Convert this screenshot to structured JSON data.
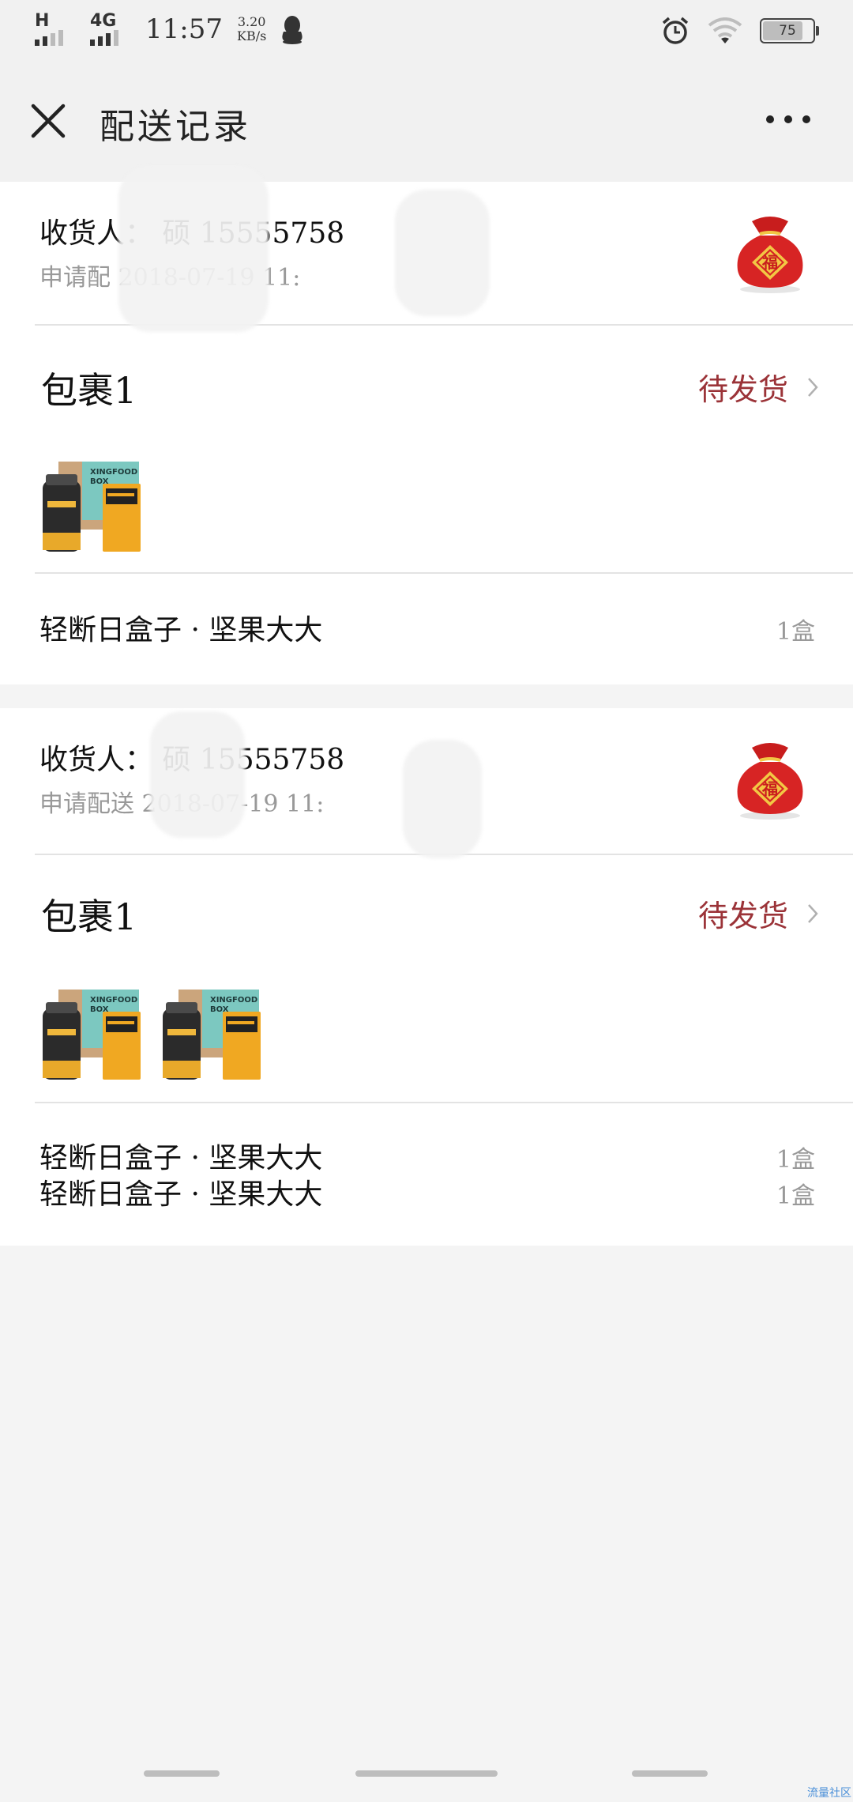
{
  "status_bar": {
    "net_h": "H",
    "net_4g": "4G",
    "time": "11:57",
    "speed_value": "3.20",
    "speed_unit": "KB/s",
    "battery": "75"
  },
  "nav": {
    "title": "配送记录"
  },
  "deliveries": [
    {
      "recipient": "收货人：  硕 15555758",
      "apply_time": "申请配  2018-07-19 11:",
      "package_title": "包裹1",
      "status": "待发货",
      "thumb_count": 1,
      "items": [
        {
          "name": "轻断日盒子 · 坚果大大",
          "qty": "1盒"
        }
      ]
    },
    {
      "recipient": "收货人：  硕 15555758",
      "apply_time": "申请配送  2018-07-19 11:",
      "package_title": "包裹1",
      "status": "待发货",
      "thumb_count": 2,
      "items": [
        {
          "name": "轻断日盒子 · 坚果大大",
          "qty": "1盒"
        },
        {
          "name": "轻断日盒子 · 坚果大大",
          "qty": "1盒"
        }
      ]
    }
  ],
  "icons": {
    "close": "close-icon",
    "more": "more-icon",
    "lucky_bag": "lucky-bag-icon",
    "chevron": "chevron-right-icon"
  },
  "colors": {
    "status": "#9b3338",
    "page_bg": "#f4f4f4",
    "muted": "#999999"
  },
  "watermark": "流量社区"
}
